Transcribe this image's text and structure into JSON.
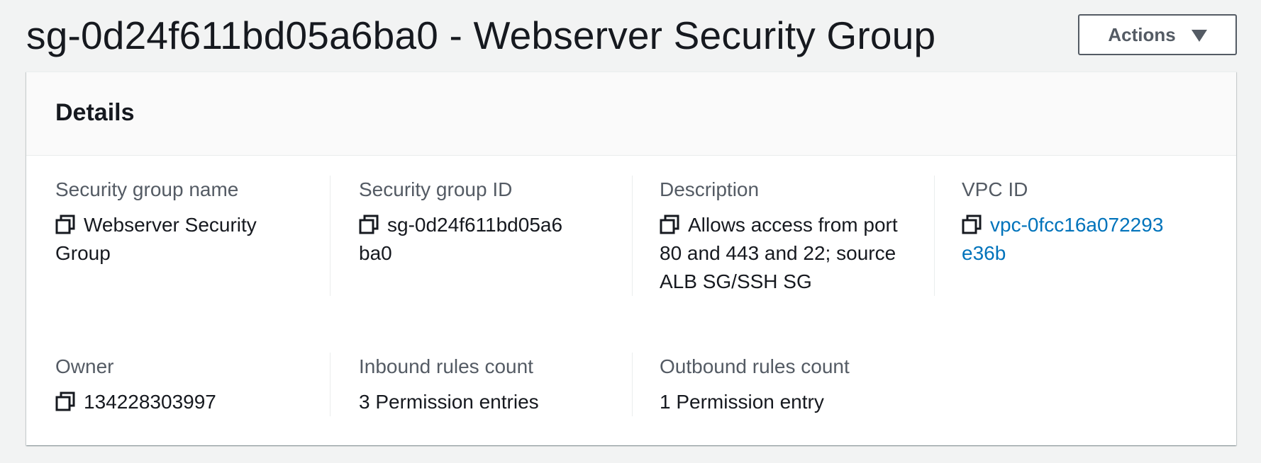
{
  "page": {
    "title": "sg-0d24f611bd05a6ba0 - Webserver Security Group",
    "actions_label": "Actions"
  },
  "details": {
    "title": "Details",
    "fields": {
      "sg_name": {
        "label": "Security group name",
        "value": "Webserver Security Group",
        "icon": "copy-icon"
      },
      "sg_id": {
        "label": "Security group ID",
        "value": "sg-0d24f611bd05a6ba0",
        "icon": "copy-icon"
      },
      "description": {
        "label": "Description",
        "value": "Allows access from port 80 and 443 and 22; source ALB SG/SSH SG",
        "icon": "copy-icon"
      },
      "vpc_id": {
        "label": "VPC ID",
        "value": "vpc-0fcc16a072293e36b",
        "icon": "copy-icon"
      },
      "owner": {
        "label": "Owner",
        "value": "134228303997",
        "icon": "copy-icon"
      },
      "inbound": {
        "label": "Inbound rules count",
        "value": "3 Permission entries"
      },
      "outbound": {
        "label": "Outbound rules count",
        "value": "1 Permission entry"
      }
    }
  },
  "colors": {
    "page_background": "#f2f3f3",
    "text": "#16191f",
    "label": "#545b64",
    "link": "#0073bb"
  }
}
